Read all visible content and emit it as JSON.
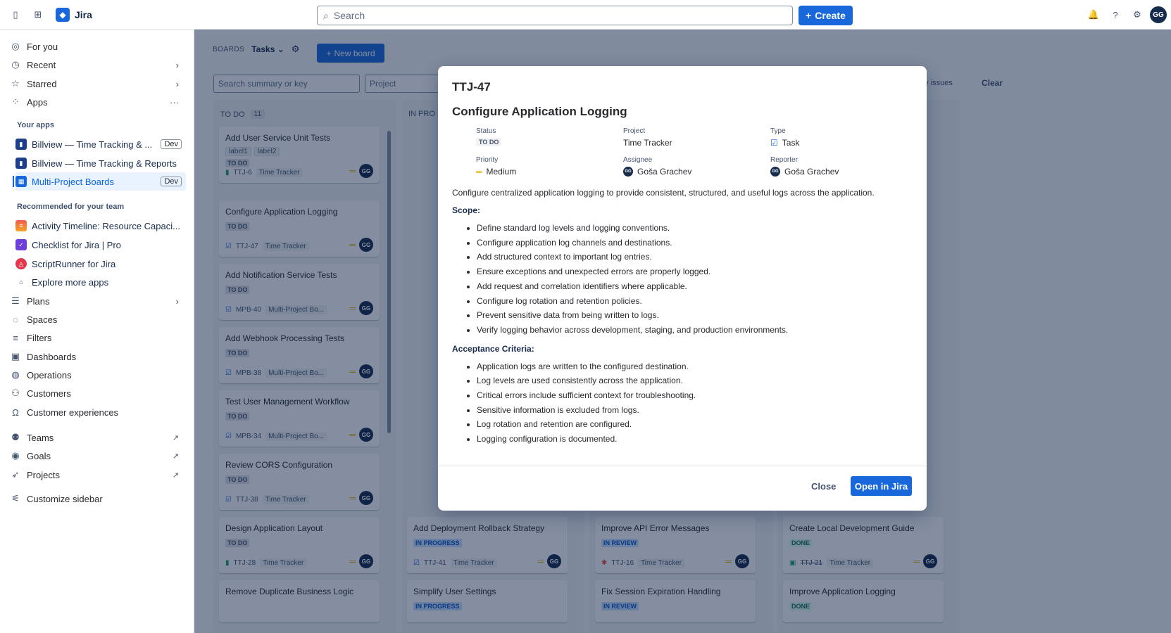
{
  "topbar": {
    "app_name": "Jira",
    "search_placeholder": "Search",
    "create_label": "Create",
    "avatar_initials": "GG"
  },
  "sidebar": {
    "for_you": "For you",
    "recent": "Recent",
    "starred": "Starred",
    "apps": "Apps",
    "your_apps_label": "Your apps",
    "your_apps": [
      {
        "label": "Billview — Time Tracking & ...",
        "badge": "Dev"
      },
      {
        "label": "Billview — Time Tracking & Reports"
      },
      {
        "label": "Multi-Project Boards",
        "badge": "Dev"
      }
    ],
    "recommended_label": "Recommended for your team",
    "recommended": [
      {
        "label": "Activity Timeline: Resource Capaci..."
      },
      {
        "label": "Checklist for Jira | Pro"
      },
      {
        "label": "ScriptRunner for Jira"
      },
      {
        "label": "Explore more apps"
      }
    ],
    "plans": "Plans",
    "spaces": "Spaces",
    "filters": "Filters",
    "dashboards": "Dashboards",
    "operations": "Operations",
    "customers": "Customers",
    "customer_experiences": "Customer experiences",
    "teams": "Teams",
    "goals": "Goals",
    "projects": "Projects",
    "customize": "Customize sidebar"
  },
  "board": {
    "boards_label": "BOARDS",
    "board_name": "Tasks",
    "new_board": "New board",
    "search_placeholder": "Search summary or key",
    "project_placeholder": "Project",
    "my_issues": "My issues",
    "clear": "Clear",
    "columns": [
      {
        "title": "TO DO",
        "count": "11"
      },
      {
        "title": "IN PRO"
      }
    ],
    "todo_cards": [
      {
        "title": "Add User Service Unit Tests",
        "labels": [
          "label1",
          "label2"
        ],
        "status": "TO DO",
        "key": "TTJ-6",
        "project": "Time Tracker"
      },
      {
        "title": "Configure Application Logging",
        "status": "TO DO",
        "key": "TTJ-47",
        "project": "Time Tracker"
      },
      {
        "title": "Add Notification Service Tests",
        "status": "TO DO",
        "key": "MPB-40",
        "project": "Multi-Project Bo..."
      },
      {
        "title": "Add Webhook Processing Tests",
        "status": "TO DO",
        "key": "MPB-38",
        "project": "Multi-Project Bo..."
      },
      {
        "title": "Test User Management Workflow",
        "status": "TO DO",
        "key": "MPB-34",
        "project": "Multi-Project Bo..."
      },
      {
        "title": "Review CORS Configuration",
        "status": "TO DO",
        "key": "TTJ-38",
        "project": "Time Tracker"
      },
      {
        "title": "Design Application Layout",
        "status": "TO DO",
        "key": "TTJ-28",
        "project": "Time Tracker"
      },
      {
        "title": "Remove Duplicate Business Logic"
      }
    ],
    "bottom_cards": [
      {
        "title": "Add Deployment Rollback Strategy",
        "status": "IN PROGRESS",
        "key": "TTJ-41",
        "project": "Time Tracker"
      },
      {
        "title": "Simplify User Settings",
        "status": "IN PROGRESS"
      },
      {
        "title": "Improve API Error Messages",
        "status": "IN REVIEW",
        "key": "TTJ-16",
        "project": "Time Tracker"
      },
      {
        "title": "Fix Session Expiration Handling",
        "status": "IN REVIEW"
      },
      {
        "title": "Create Local Development Guide",
        "status": "DONE",
        "key": "TTJ-21",
        "project": "Time Tracker"
      },
      {
        "title": "Improve Application Logging",
        "status": "DONE"
      }
    ]
  },
  "modal": {
    "key": "TTJ-47",
    "title": "Configure Application Logging",
    "fields": {
      "status_label": "Status",
      "status_value": "TO DO",
      "project_label": "Project",
      "project_value": "Time Tracker",
      "type_label": "Type",
      "type_value": "Task",
      "priority_label": "Priority",
      "priority_value": "Medium",
      "assignee_label": "Assignee",
      "assignee_value": "Goša Grachev",
      "reporter_label": "Reporter",
      "reporter_value": "Goša Grachev"
    },
    "description": "Configure centralized application logging to provide consistent, structured, and useful logs across the application.",
    "scope_heading": "Scope:",
    "scope": [
      "Define standard log levels and logging conventions.",
      "Configure application log channels and destinations.",
      "Add structured context to important log entries.",
      "Ensure exceptions and unexpected errors are properly logged.",
      "Add request and correlation identifiers where applicable.",
      "Configure log rotation and retention policies.",
      "Prevent sensitive data from being written to logs.",
      "Verify logging behavior across development, staging, and production environments."
    ],
    "acceptance_heading": "Acceptance Criteria:",
    "acceptance": [
      "Application logs are written to the configured destination.",
      "Log levels are used consistently across the application.",
      "Critical errors include sufficient context for troubleshooting.",
      "Sensitive information is excluded from logs.",
      "Log rotation and retention are configured.",
      "Logging configuration is documented."
    ],
    "close_label": "Close",
    "open_label": "Open in Jira"
  },
  "colors": {
    "accent": "#1868db",
    "overlay": "#091e4280",
    "priority_medium": "#e2b203"
  }
}
